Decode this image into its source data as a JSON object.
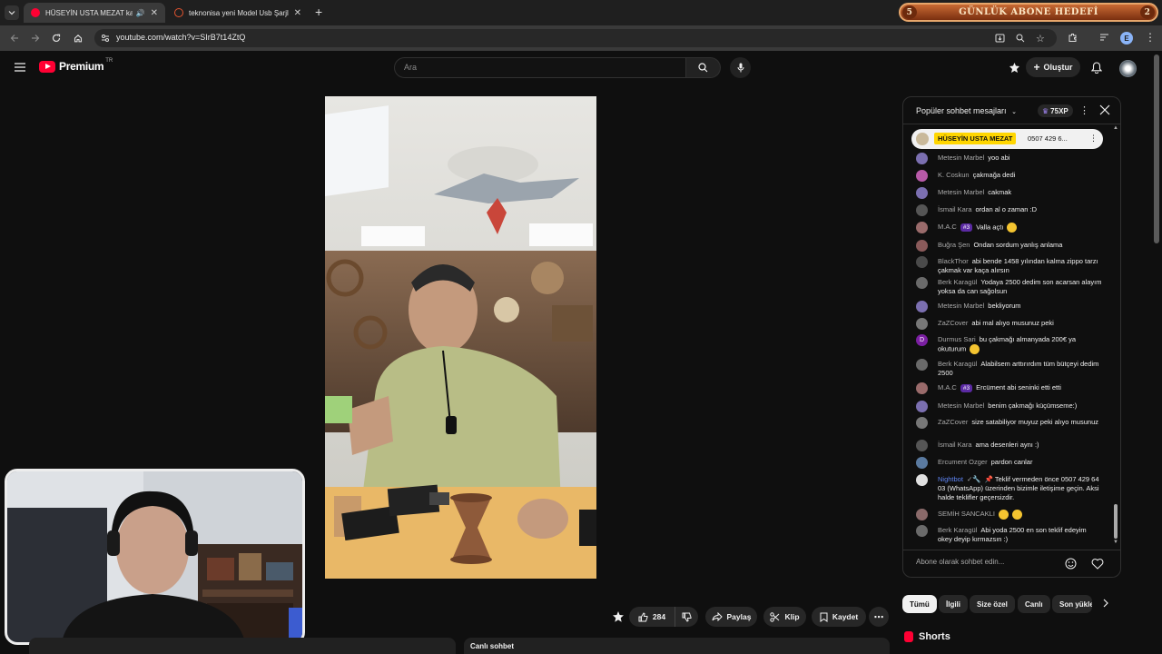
{
  "browser": {
    "tabs": [
      {
        "title": "HÜSEYİN USTA MEZAT kanalı",
        "active": true
      },
      {
        "title": "teknonisa yeni Model Usb Şarjlı",
        "active": false
      }
    ],
    "new_tab": "+",
    "url": "youtube.com/watch?v=SIrB7t14ZtQ",
    "profile_initial": "E"
  },
  "banner": {
    "left_num": "5",
    "text": "GÜNLÜK ABONE HEDEFİ",
    "right_num": "2"
  },
  "youtube": {
    "logo_text": "Premium",
    "region": "TR",
    "search_placeholder": "Ara",
    "create_label": "Oluştur"
  },
  "chat": {
    "header": "Popüler sohbet mesajları",
    "xp": "75XP",
    "pinned": {
      "author": "HÜSEYİN USTA MEZAT",
      "text": "0507 429 6..."
    },
    "messages": [
      {
        "author": "Metesin Marbel",
        "text": "yoo abi",
        "color": "#7b6fb0"
      },
      {
        "author": "K. Coskun",
        "text": "çakmağa dedi",
        "color": "#b85aa8"
      },
      {
        "author": "Metesin Marbel",
        "text": "cakmak",
        "color": "#7b6fb0"
      },
      {
        "author": "İsmail Kara",
        "text": "ordan al o zaman :D",
        "color": "#555"
      },
      {
        "author": "M.A.C",
        "tag": "#3",
        "text": "Valla açtı",
        "color": "#9a6b6b",
        "emoji": true
      },
      {
        "author": "Buğra Şen",
        "text": "Ondan sordum yanlış anlama",
        "color": "#8a5a5a"
      },
      {
        "author": "BlackThor",
        "text": "abi bende 1458 yılından kalma zippo tarzı çakmak var kaça alırsın",
        "color": "#4a4a4a"
      },
      {
        "author": "Berk Karagül",
        "text": "Yodaya 2500 dedim son acarsan alayım yoksa da can sağolsun",
        "color": "#6a6a6a"
      },
      {
        "author": "Metesin Marbel",
        "text": "bekliyorum",
        "color": "#7b6fb0"
      },
      {
        "author": "ZaZCover",
        "text": "abi mal alıyo musunuz peki",
        "color": "#777"
      },
      {
        "author": "Durmus Sari",
        "text": "bu çakmağı almanyada 200€ ya okuturum",
        "color": "#7b1fa2",
        "initial": "D",
        "emoji": true
      },
      {
        "author": "Berk Karagül",
        "text": "Alabilsem arttırırdım tüm bütçeyi dedim 2500",
        "color": "#6a6a6a"
      },
      {
        "author": "M.A.C",
        "tag": "#3",
        "text": "Ercüment abi seninki etti etti",
        "color": "#9a6b6b"
      },
      {
        "author": "Metesin Marbel",
        "text": "benim çakmağı küçümseme:)",
        "color": "#7b6fb0"
      },
      {
        "author": "ZaZCover",
        "text": "size satabiliyor muyuz peki alıyo musunuz",
        "color": "#777"
      },
      {
        "author": "İsmail Kara",
        "text": "ama desenleri aynı :)",
        "color": "#555"
      },
      {
        "author": "Ercument Ozger",
        "text": "pardon canlar",
        "color": "#5a7aa0"
      },
      {
        "author": "Nightbot",
        "mod": true,
        "text": "📌 Teklif vermeden önce 0507 429 64 03 (WhatsApp) üzerinden bizimle iletişime geçin. Aksi halde teklifler geçersizdir.",
        "color": "#e0e0e0"
      },
      {
        "author": "SEMİH SANCAKLI",
        "text": "",
        "color": "#8a6a6a",
        "emoji2": true
      },
      {
        "author": "Berk Karagül",
        "text": "Abi yoda 2500 en son teklif edeyim okey deyip kırmazsın :)",
        "color": "#6a6a6a"
      }
    ],
    "input_placeholder": "Abone olarak sohbet edin..."
  },
  "actions": {
    "likes": "284",
    "share": "Paylaş",
    "clip": "Klip",
    "save": "Kaydet"
  },
  "chips": [
    "Tümü",
    "İlgili",
    "Size özel",
    "Canlı",
    "Son yükle"
  ],
  "shorts_label": "Shorts",
  "live_chat_bar": "Canlı sohbet"
}
